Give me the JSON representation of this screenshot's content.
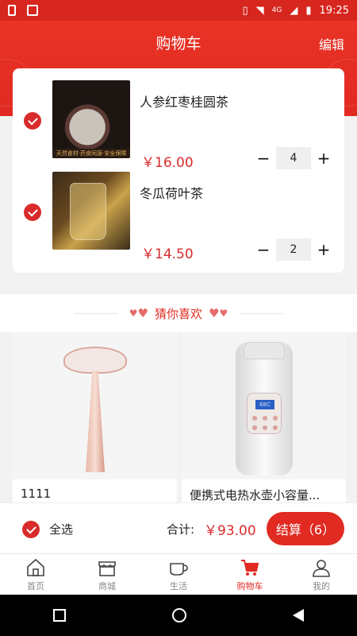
{
  "status_bar": {
    "time": "19:25",
    "network": "4G"
  },
  "header": {
    "title": "购物车",
    "edit_label": "编辑"
  },
  "cart": {
    "items": [
      {
        "name": "人参红枣桂圆茶",
        "price": "￥16.00",
        "quantity": "4",
        "image_strip": "天然食材·药食同源·安全保障"
      },
      {
        "name": "冬瓜荷叶茶",
        "price": "￥14.50",
        "quantity": "2"
      }
    ],
    "minus": "−",
    "plus": "+"
  },
  "recommend": {
    "title": "猜你喜欢",
    "heart": "♥"
  },
  "products": [
    {
      "name": "1111"
    },
    {
      "name": "便携式电热水壶小容量..."
    }
  ],
  "kettle_display": "68C",
  "checkout": {
    "select_all": "全选",
    "total_label": "合计:",
    "total_value": "￥93.00",
    "button": "结算（6）"
  },
  "tabbar": {
    "tabs": [
      {
        "label": "首页",
        "icon": "home-icon"
      },
      {
        "label": "商城",
        "icon": "store-icon"
      },
      {
        "label": "生活",
        "icon": "cup-icon"
      },
      {
        "label": "购物车",
        "icon": "cart-icon",
        "active": true
      },
      {
        "label": "我的",
        "icon": "user-icon"
      }
    ]
  },
  "colors": {
    "accent": "#e02a22",
    "price": "#d92b2b"
  }
}
